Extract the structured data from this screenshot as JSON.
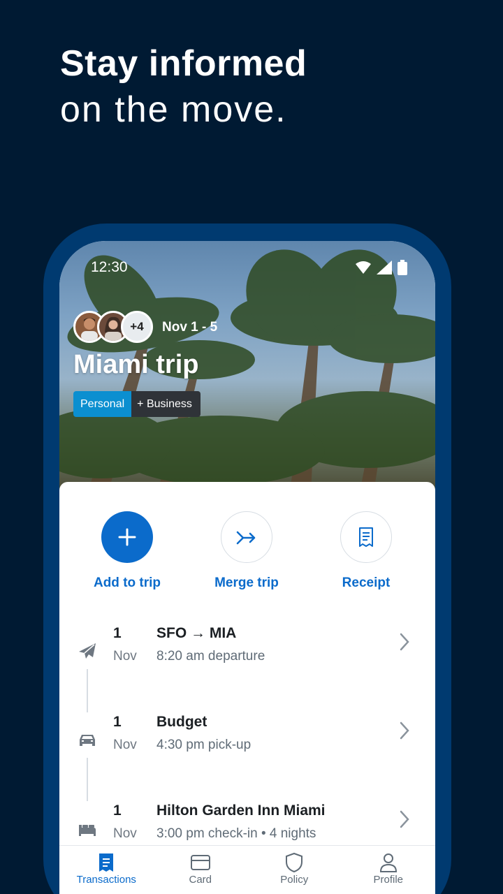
{
  "headline": {
    "line1": "Stay informed",
    "line2": "on the move."
  },
  "status_bar": {
    "time": "12:30",
    "icons": [
      "wifi-icon",
      "signal-icon",
      "battery-icon"
    ]
  },
  "trip": {
    "extra_members": "+4",
    "dates": "Nov 1 - 5",
    "title": "Miami trip",
    "tag_personal": "Personal",
    "tag_business": "+ Business"
  },
  "actions": [
    {
      "label": "Add to trip",
      "icon": "plus-icon"
    },
    {
      "label": "Merge trip",
      "icon": "merge-arrow-icon"
    },
    {
      "label": "Receipt",
      "icon": "receipt-icon"
    }
  ],
  "timeline": [
    {
      "icon": "plane-icon",
      "day": "1",
      "month": "Nov",
      "title": "SFO → MIA",
      "subtitle": "8:20 am departure"
    },
    {
      "icon": "car-icon",
      "day": "1",
      "month": "Nov",
      "title": "Budget",
      "subtitle": "4:30 pm pick-up"
    },
    {
      "icon": "bed-icon",
      "day": "1",
      "month": "Nov",
      "title": "Hilton Garden Inn Miami",
      "subtitle": "3:00 pm check-in • 4 nights"
    }
  ],
  "tabs": [
    {
      "label": "Transactions",
      "icon": "receipt-tab-icon",
      "active": true
    },
    {
      "label": "Card",
      "icon": "card-icon",
      "active": false
    },
    {
      "label": "Policy",
      "icon": "shield-icon",
      "active": false
    },
    {
      "label": "Profile",
      "icon": "person-icon",
      "active": false
    }
  ],
  "colors": {
    "background": "#001a33",
    "frame": "#003a70",
    "accent": "#0b6bcb",
    "tag_personal": "#0b8fd0"
  }
}
